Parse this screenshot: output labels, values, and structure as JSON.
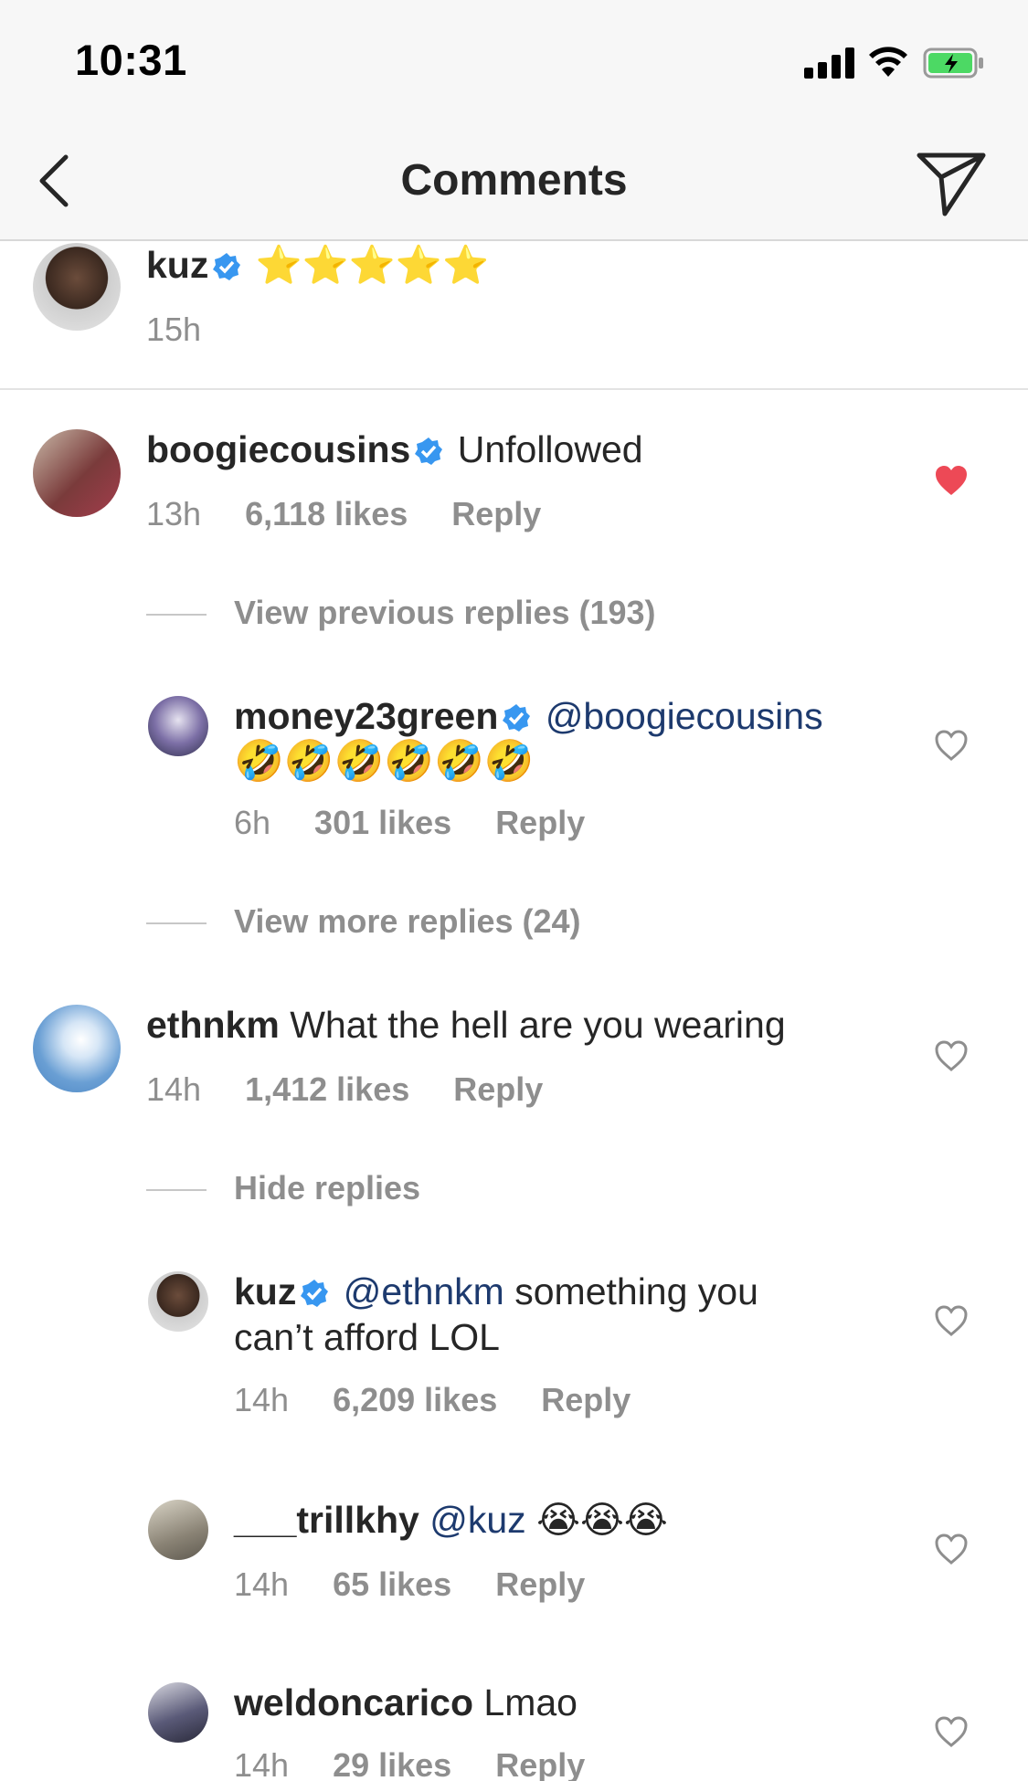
{
  "status_bar": {
    "time": "10:31"
  },
  "nav": {
    "title": "Comments"
  },
  "comments": [
    {
      "user": "kuz",
      "verified": true,
      "text": "⭐⭐⭐⭐⭐",
      "time": "15h"
    },
    {
      "user": "boogiecousins",
      "verified": true,
      "text": "Unfollowed",
      "time": "13h",
      "likes": "6,118 likes",
      "reply": "Reply",
      "liked": true,
      "view_previous": "View previous replies (193)",
      "replies": [
        {
          "user": "money23green",
          "verified": true,
          "mention": "@boogiecousins",
          "text": "🤣🤣🤣🤣🤣🤣",
          "time": "6h",
          "likes": "301 likes",
          "reply": "Reply"
        }
      ],
      "view_more": "View more replies (24)"
    },
    {
      "user": "ethnkm",
      "verified": false,
      "text": "What the hell are you wearing",
      "time": "14h",
      "likes": "1,412 likes",
      "reply": "Reply",
      "hide_replies": "Hide replies",
      "replies": [
        {
          "user": "kuz",
          "verified": true,
          "mention": "@ethnkm",
          "text": "something you",
          "text2": "can’t afford LOL",
          "time": "14h",
          "likes": "6,209 likes",
          "reply": "Reply"
        },
        {
          "user": "___trillkhy",
          "verified": false,
          "mention": "@kuz",
          "text": "😭😭😭",
          "time": "14h",
          "likes": "65 likes",
          "reply": "Reply"
        },
        {
          "user": "weldoncarico",
          "verified": false,
          "text": "Lmao",
          "time": "14h",
          "likes": "29 likes",
          "reply": "Reply"
        }
      ]
    }
  ],
  "colors": {
    "accent_blue": "#3897f0",
    "like_red": "#ed4956",
    "meta_gray": "#8e8e8e",
    "mention_blue": "#1d3a6e"
  },
  "icons": [
    "back-icon",
    "direct-share-icon",
    "verified-icon",
    "heart-icon",
    "heart-filled-icon",
    "signal-icon",
    "wifi-icon",
    "battery-icon"
  ]
}
